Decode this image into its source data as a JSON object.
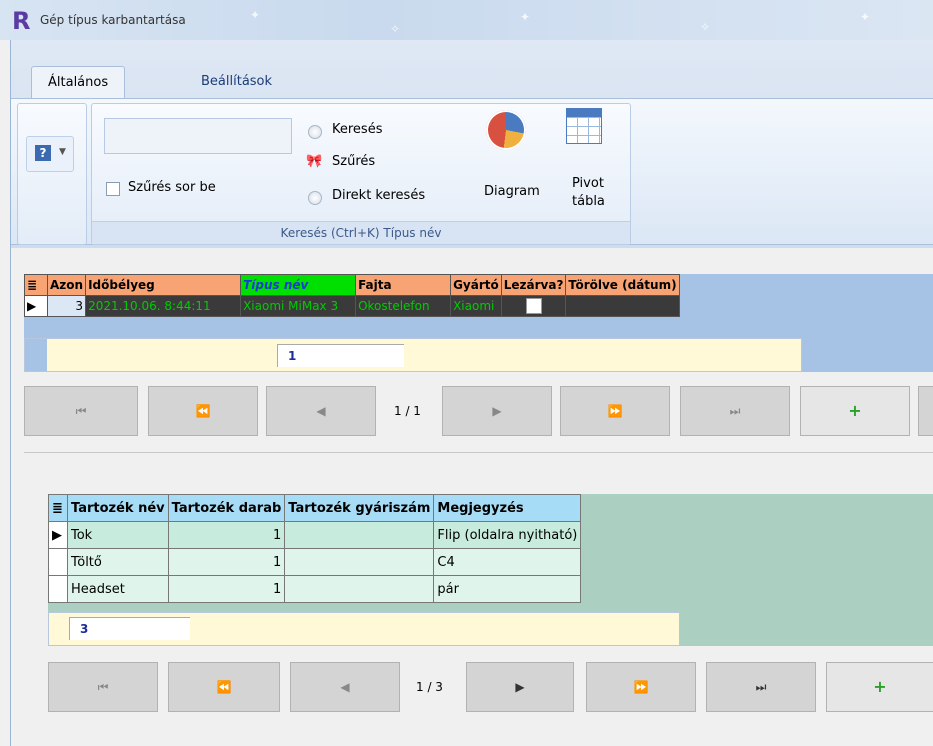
{
  "window": {
    "title": "Gép típus karbantartása",
    "logo": "R"
  },
  "ribbon": {
    "tabs": [
      "Általános",
      "Beállítások"
    ],
    "filter_row_label": "Szűrés sor be",
    "search_label": "Keresés",
    "filter_label": "Szűrés",
    "direct_search_label": "Direkt keresés",
    "diagram_label": "Diagram",
    "pivot_label_1": "Pivot",
    "pivot_label_2": "tábla",
    "group_label": "Keresés (Ctrl+K) Típus név",
    "search_value": ""
  },
  "grid1": {
    "headers": [
      "Azon",
      "Időbélyeg",
      "Típus név",
      "Fajta",
      "Gyártó",
      "Lezárva?",
      "Törölve (dátum)"
    ],
    "rows": [
      {
        "azon": "3",
        "idobelyeg": "2021.10.06. 8:44:11",
        "tipus": "Xiaomi MiMax 3",
        "fajta": "Okostelefon",
        "gyarto": "Xiaomi",
        "lezarva": "",
        "torolve": ""
      }
    ],
    "total": "1"
  },
  "nav1": {
    "page": "1 / 1"
  },
  "grid2": {
    "headers": [
      "Tartozék név",
      "Tartozék darab",
      "Tartozék gyáriszám",
      "Megjegyzés"
    ],
    "rows": [
      {
        "nev": "Tok",
        "darab": "1",
        "gyariszam": "",
        "megjegyzes": "Flip (oldalra nyitható)"
      },
      {
        "nev": "Töltő",
        "darab": "1",
        "gyariszam": "",
        "megjegyzes": "C4"
      },
      {
        "nev": "Headset",
        "darab": "1",
        "gyariszam": "",
        "megjegyzes": "pár"
      }
    ],
    "total": "3"
  },
  "nav2": {
    "page": "1 / 3"
  },
  "icons": {
    "help": "help-icon",
    "filter": "bow-filter-icon",
    "diagram": "pie-chart-icon",
    "pivot": "table-grid-icon",
    "first": "first-page-icon",
    "prev_page": "previous-page-icon",
    "prev": "previous-icon",
    "next": "next-icon",
    "next_page": "next-page-icon",
    "last": "last-page-icon",
    "add": "plus-icon"
  }
}
